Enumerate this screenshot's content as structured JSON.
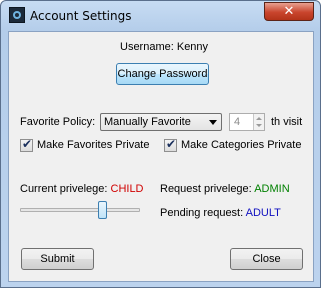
{
  "window": {
    "title": "Account Settings",
    "close_symbol": "✕",
    "icon": "app-icon"
  },
  "user": {
    "label": "Username: Kenny",
    "change_password_label": "Change Password"
  },
  "favorite_policy": {
    "label": "Favorite Policy:",
    "selected": "Manually Favorite",
    "visit_count": "4",
    "visit_suffix": "th visit"
  },
  "options": {
    "make_favorites_private": {
      "label": "Make Favorites Private",
      "checked": true
    },
    "make_categories_private": {
      "label": "Make Categories Private",
      "checked": true
    },
    "check_glyph": "✔"
  },
  "privilege": {
    "current_label": "Current privelege:",
    "current_value": "CHILD",
    "request_label": "Request privelege:",
    "request_value": "ADMIN",
    "pending_label": "Pending request:",
    "pending_value": "ADULT",
    "slider_level": 0.7
  },
  "actions": {
    "submit_label": "Submit",
    "close_label": "Close"
  },
  "colors": {
    "current_value": "#d00000",
    "request_value": "#008000",
    "pending_value": "#1010c0"
  }
}
